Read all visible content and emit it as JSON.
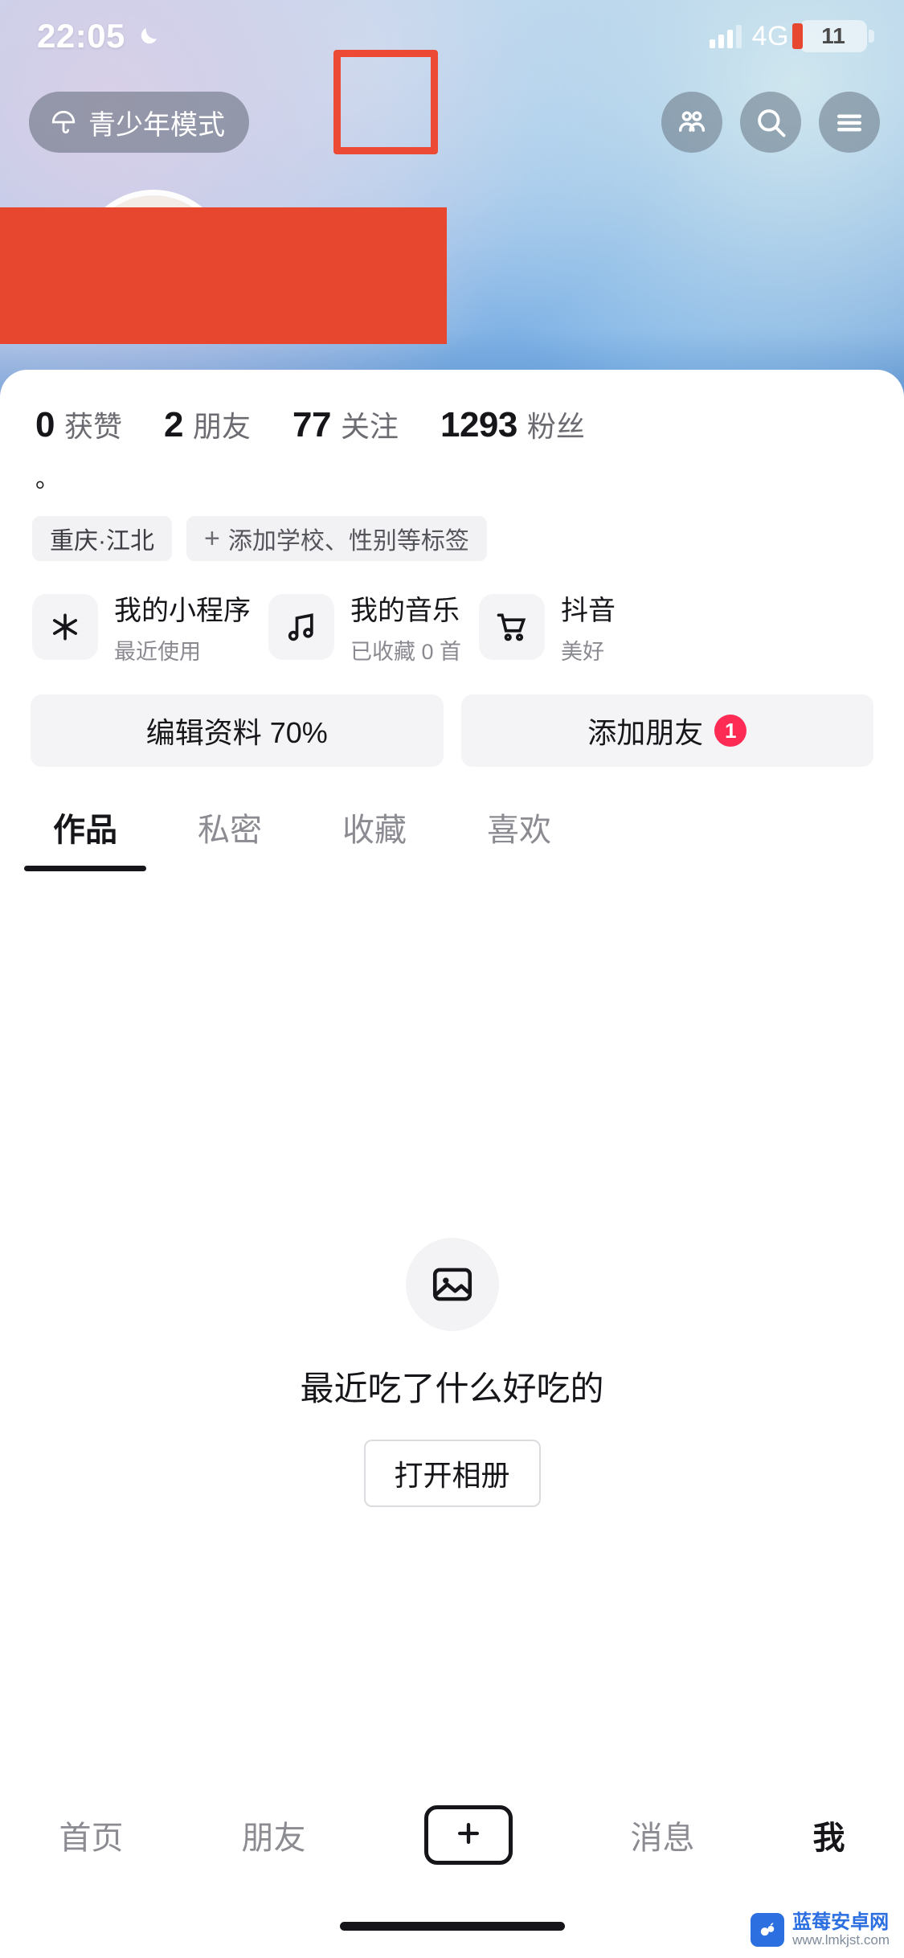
{
  "status_bar": {
    "time": "22:05",
    "moon_icon": "crescent-moon-icon",
    "network": "4G",
    "battery_percent": "11",
    "signal_icon": "signal-bars-icon"
  },
  "header": {
    "teen_mode_label": "青少年模式",
    "teen_mode_icon": "umbrella-icon",
    "friends_icon": "people-icon",
    "search_icon": "search-icon",
    "menu_icon": "hamburger-menu-icon",
    "annotation_color": "#ec4a34",
    "annotation_target": "friends-icon-button"
  },
  "profile": {
    "stats": [
      {
        "num": "0",
        "label": "获赞"
      },
      {
        "num": "2",
        "label": "朋友"
      },
      {
        "num": "77",
        "label": "关注"
      },
      {
        "num": "1293",
        "label": "粉丝"
      }
    ],
    "bio": "。",
    "tags": [
      {
        "text": "重庆·江北",
        "type": "location"
      },
      {
        "text": "添加学校、性别等标签",
        "type": "add",
        "plus": "+"
      }
    ],
    "quick_entries": [
      {
        "icon": "mini-program-icon",
        "title": "我的小程序",
        "subtitle": "最近使用"
      },
      {
        "icon": "music-note-icon",
        "title": "我的音乐",
        "subtitle": "已收藏 0 首"
      },
      {
        "icon": "shopping-cart-icon",
        "title": "抖音",
        "subtitle": "美好"
      }
    ],
    "actions": [
      {
        "label": "编辑资料 70%",
        "badge": null
      },
      {
        "label": "添加朋友",
        "badge": "1"
      }
    ]
  },
  "tabs": [
    {
      "label": "作品",
      "active": true
    },
    {
      "label": "私密",
      "active": false
    },
    {
      "label": "收藏",
      "active": false
    },
    {
      "label": "喜欢",
      "active": false
    }
  ],
  "empty_state": {
    "icon": "image-placeholder-icon",
    "title": "最近吃了什么好吃的",
    "button_label": "打开相册"
  },
  "bottom_nav": [
    {
      "label": "首页",
      "active": false
    },
    {
      "label": "朋友",
      "active": false
    },
    {
      "label": "+",
      "active": false,
      "type": "plus"
    },
    {
      "label": "消息",
      "active": false
    },
    {
      "label": "我",
      "active": true
    }
  ],
  "watermark": {
    "line1": "蓝莓安卓网",
    "line2": "www.lmkjst.com",
    "icon": "blueberry-logo-icon",
    "color": "#2b6fe0"
  },
  "colors": {
    "accent_red": "#e8472f",
    "badge_red": "#fe2c55",
    "text_primary": "#16161a",
    "text_secondary": "#8b8b92"
  }
}
